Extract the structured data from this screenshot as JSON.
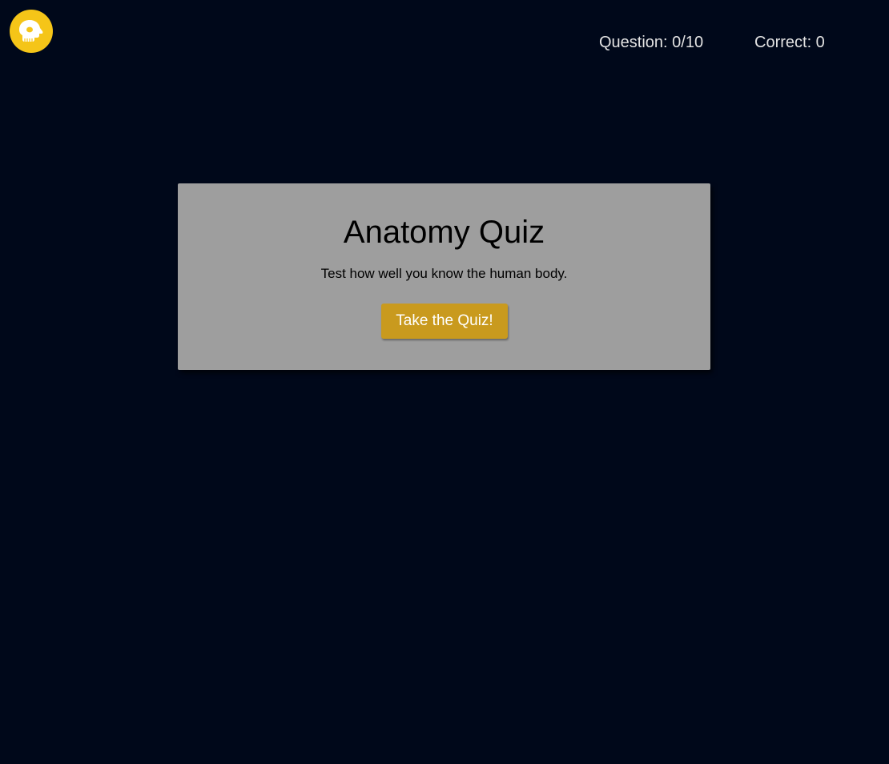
{
  "header": {
    "logo_icon": "skull-icon",
    "question_counter": "Question: 0/10",
    "correct_counter": "Correct: 0"
  },
  "card": {
    "title": "Anatomy Quiz",
    "subtitle": "Test how well you know the human body.",
    "start_button_label": "Take the Quiz!"
  },
  "colors": {
    "background": "#00081a",
    "logo": "#f5c518",
    "card": "#9e9e9e",
    "button": "#c99a1e"
  }
}
